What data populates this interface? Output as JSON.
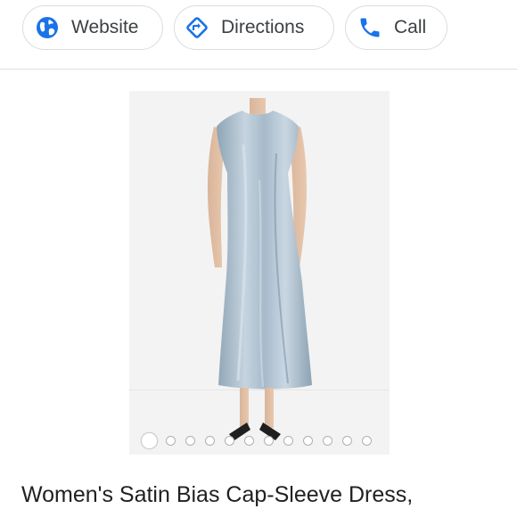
{
  "actions": {
    "website_label": "Website",
    "directions_label": "Directions",
    "call_label": "Call"
  },
  "colors": {
    "accent": "#1a73e8",
    "chip_border": "#dadce0",
    "dress": "#aebfcc"
  },
  "icons": [
    "globe-icon",
    "directions-icon",
    "phone-icon"
  ],
  "product": {
    "title": "Women's Satin Bias Cap-Sleeve Dress,",
    "image_count": 12,
    "active_image_index": 0
  }
}
